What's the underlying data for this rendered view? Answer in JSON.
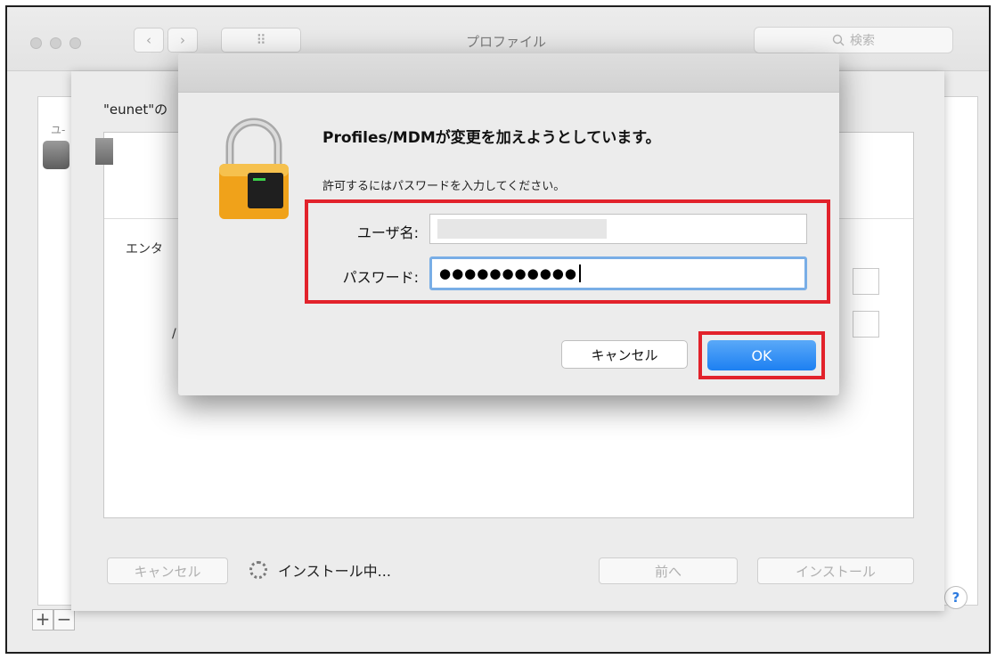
{
  "window": {
    "title": "プロファイル",
    "search_placeholder": "検索",
    "back_glyph": "‹",
    "forward_glyph": "›",
    "grid_glyph": "⠿"
  },
  "sidebar": {
    "header_label": "ユ-"
  },
  "sheet": {
    "title": "\"eunet\"の",
    "field_label_1": "エンタ",
    "field_label_2": "/",
    "cancel_label": "キャンセル",
    "progress_text": "インストール中...",
    "back_label": "前へ",
    "install_label": "インストール"
  },
  "dialog": {
    "heading": "Profiles/MDMが変更を加えようとしています。",
    "subtitle": "許可するにはパスワードを入力してください。",
    "username_label": "ユーザ名:",
    "password_label": "パスワード:",
    "password_value": "●●●●●●●●●●●",
    "cancel_label": "キャンセル",
    "ok_label": "OK"
  },
  "footer": {
    "plus": "+",
    "minus": "−",
    "help": "?"
  },
  "colors": {
    "highlight": "#e2222b",
    "accent": "#1d80f2",
    "focus_ring": "#79aee6"
  },
  "icons": [
    "lock-icon",
    "search-icon",
    "gear-icon",
    "spinner-icon",
    "help-icon"
  ]
}
